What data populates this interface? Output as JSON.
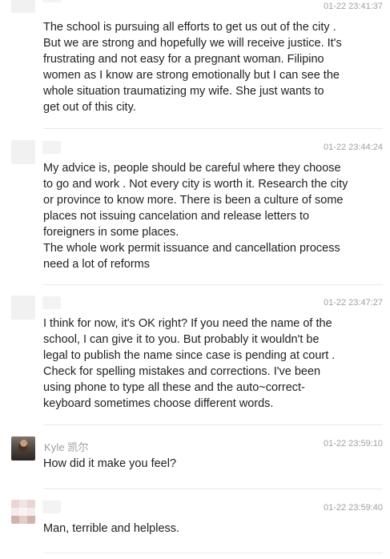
{
  "comments": [
    {
      "name": "",
      "time": "01-22 23:41:37",
      "text": "The school is pursuing all efforts to get us out of the city .\nBut we are strong and hopefully we will receive justice. It's\nfrustrating and not easy for a pregnant woman. Filipino\nwomen as I know are strong emotionally but I can see the\nwhole situation traumatizing my wife. She just wants to\nget out of this city."
    },
    {
      "name": "",
      "time": "01-22 23:44:24",
      "text": "My advice is, people should be careful where they choose\nto go and work . Not every city is worth it. Research the city\nor province to know more. There is been a culture of some\nplaces not issuing cancelation and release letters to\nforeigners in some places.\nThe whole work permit issuance and cancellation process\nneed a lot of reforms"
    },
    {
      "name": "",
      "time": "01-22 23:47:27",
      "text": "I think for now, it's OK right? If you need the name of the\nschool, I can give it to you. But probably it wouldn't be\nlegal to publish the name since case is pending at court .\nCheck for spelling mistakes and corrections. I've been\nusing phone to type all these and the auto~correct-\nkeyboard sometimes choose different words."
    },
    {
      "name": "Kyle 凯尔",
      "time": "01-22 23:59:10",
      "text": "How did it make you feel?"
    },
    {
      "name": "",
      "time": "01-22 23:59:40",
      "text": "Man, terrible and helpless."
    }
  ]
}
